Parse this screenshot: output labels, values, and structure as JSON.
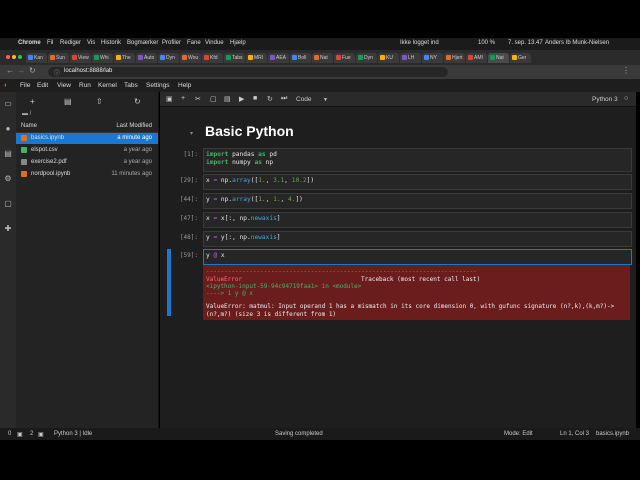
{
  "mac_menu": {
    "app": "Chrome",
    "items": [
      "Fil",
      "Rediger",
      "Vis",
      "Historik",
      "Bogmærker",
      "Profiler",
      "Fane",
      "Vindue",
      "Hjælp"
    ],
    "status_sync": "Ikke logget ind",
    "battery": "100 %",
    "datetime": "7. sep. 13.47",
    "user": "Anders Ib Munk-Nielsen"
  },
  "browser": {
    "tabs": [
      "Kan",
      "Sun",
      "View",
      "Whi",
      "The",
      "Auto",
      "Dyn",
      "Wou",
      "Kfd",
      "Tabs",
      "MRI",
      "AEA",
      "Boll",
      "Nat",
      "Fue",
      "Dyn",
      "KU",
      "LH",
      "NY",
      "Hjert",
      "AMI",
      "Nat",
      "Ger"
    ],
    "url": "localhost:8888/lab"
  },
  "jupyter_menu": [
    "File",
    "Edit",
    "View",
    "Run",
    "Kernel",
    "Tabs",
    "Settings",
    "Help"
  ],
  "filebrowser": {
    "path": "/",
    "col_name": "Name",
    "col_modified": "Last Modified",
    "files": [
      {
        "name": "basics.ipynb",
        "modified": "a minute ago",
        "color": "#e06b2a",
        "selected": true
      },
      {
        "name": "elspot.csv",
        "modified": "a year ago",
        "color": "#3fb56b",
        "selected": false
      },
      {
        "name": "exercise2.pdf",
        "modified": "a year ago",
        "color": "#888888",
        "selected": false
      },
      {
        "name": "nordpool.ipynb",
        "modified": "11 minutes ago",
        "color": "#e06b2a",
        "selected": false
      }
    ]
  },
  "notebook": {
    "cell_type": "Code",
    "kernel": "Python 3",
    "heading": "Basic Python",
    "cells": [
      {
        "prompt": "[1]:",
        "lines": [
          "import pandas as pd",
          "import numpy as np"
        ]
      },
      {
        "prompt": "[29]:",
        "lines": [
          "x = np.array([1., 3.1, 10.2])"
        ]
      },
      {
        "prompt": "[44]:",
        "lines": [
          "y = np.array([1., 1., 4.])"
        ]
      },
      {
        "prompt": "[47]:",
        "lines": [
          "x = x[:, np.newaxis]"
        ]
      },
      {
        "prompt": "[48]:",
        "lines": [
          "y = y[:, np.newaxis]"
        ]
      },
      {
        "prompt": "[59]:",
        "lines": [
          "y @ x"
        ]
      }
    ],
    "error": {
      "rule": "---------------------------------------------------------------------------",
      "name": "ValueError",
      "traceback": "Traceback (most recent call last)",
      "location": "<ipython-input-59-94c94719faa1> in <module>",
      "arrow_line": "----> 1 y @ x",
      "message_1": "ValueError: matmul: Input operand 1 has a mismatch in its core dimension 0, with gufunc signature (n?,k),(k,m?)->",
      "message_2": "(n?,m?) (size 3 is different from 1)"
    }
  },
  "statusbar": {
    "left_a": "0",
    "left_b": "2",
    "kernel_status": "Python 3 | Idle",
    "message": "Saving completed",
    "mode": "Mode: Edit",
    "position": "Ln 1, Col 3",
    "filename": "basics.ipynb"
  }
}
